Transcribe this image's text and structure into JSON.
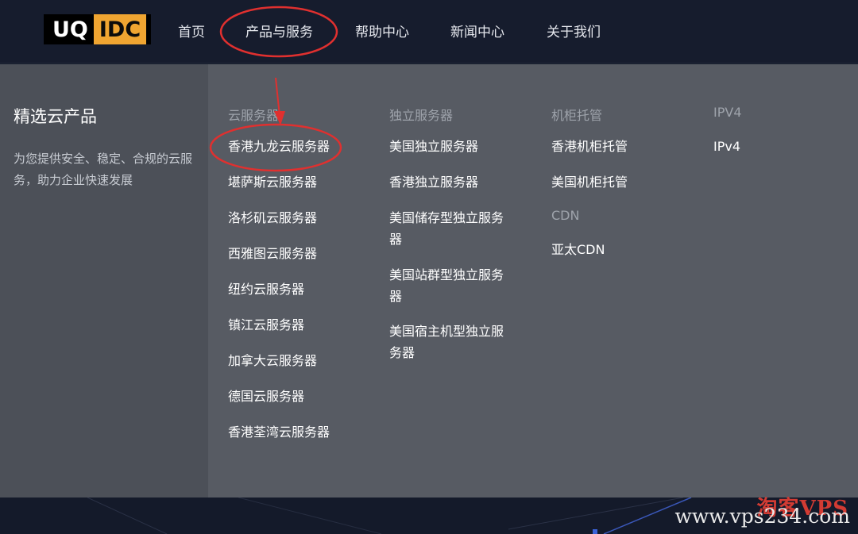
{
  "header": {
    "logo": {
      "part1": "UQ",
      "part2": "IDC"
    },
    "nav": [
      {
        "label": "首页"
      },
      {
        "label": "产品与服务"
      },
      {
        "label": "帮助中心"
      },
      {
        "label": "新闻中心"
      },
      {
        "label": "关于我们"
      }
    ]
  },
  "dropdown": {
    "title": "精选云产品",
    "description": "为您提供安全、稳定、合规的云服务，助力企业快速发展",
    "columns": [
      {
        "heading": "云服务器",
        "items": [
          "香港九龙云服务器",
          "堪萨斯云服务器",
          "洛杉矶云服务器",
          "西雅图云服务器",
          "纽约云服务器",
          "镇江云服务器",
          "加拿大云服务器",
          "德国云服务器",
          "香港荃湾云服务器"
        ]
      },
      {
        "heading": "独立服务器",
        "items": [
          "美国独立服务器",
          "香港独立服务器",
          "美国储存型独立服务器",
          "美国站群型独立服务器",
          "美国宿主机型独立服务器"
        ]
      },
      {
        "heading": "机柜托管",
        "items": [
          "香港机柜托管",
          "美国机柜托管"
        ]
      },
      {
        "heading": "CDN",
        "items": [
          "亚太CDN"
        ]
      },
      {
        "heading": "IPV4",
        "items": [
          "IPv4"
        ]
      }
    ]
  },
  "watermark": {
    "cn": "淘客VPS",
    "url": "www.vps234.com"
  },
  "colors": {
    "header_bg": "#161c2d",
    "dropdown_bg": "#575b63",
    "dropdown_left_bg": "#4c5058",
    "logo_accent": "#f0a531",
    "annotation_red": "#e0302f"
  }
}
